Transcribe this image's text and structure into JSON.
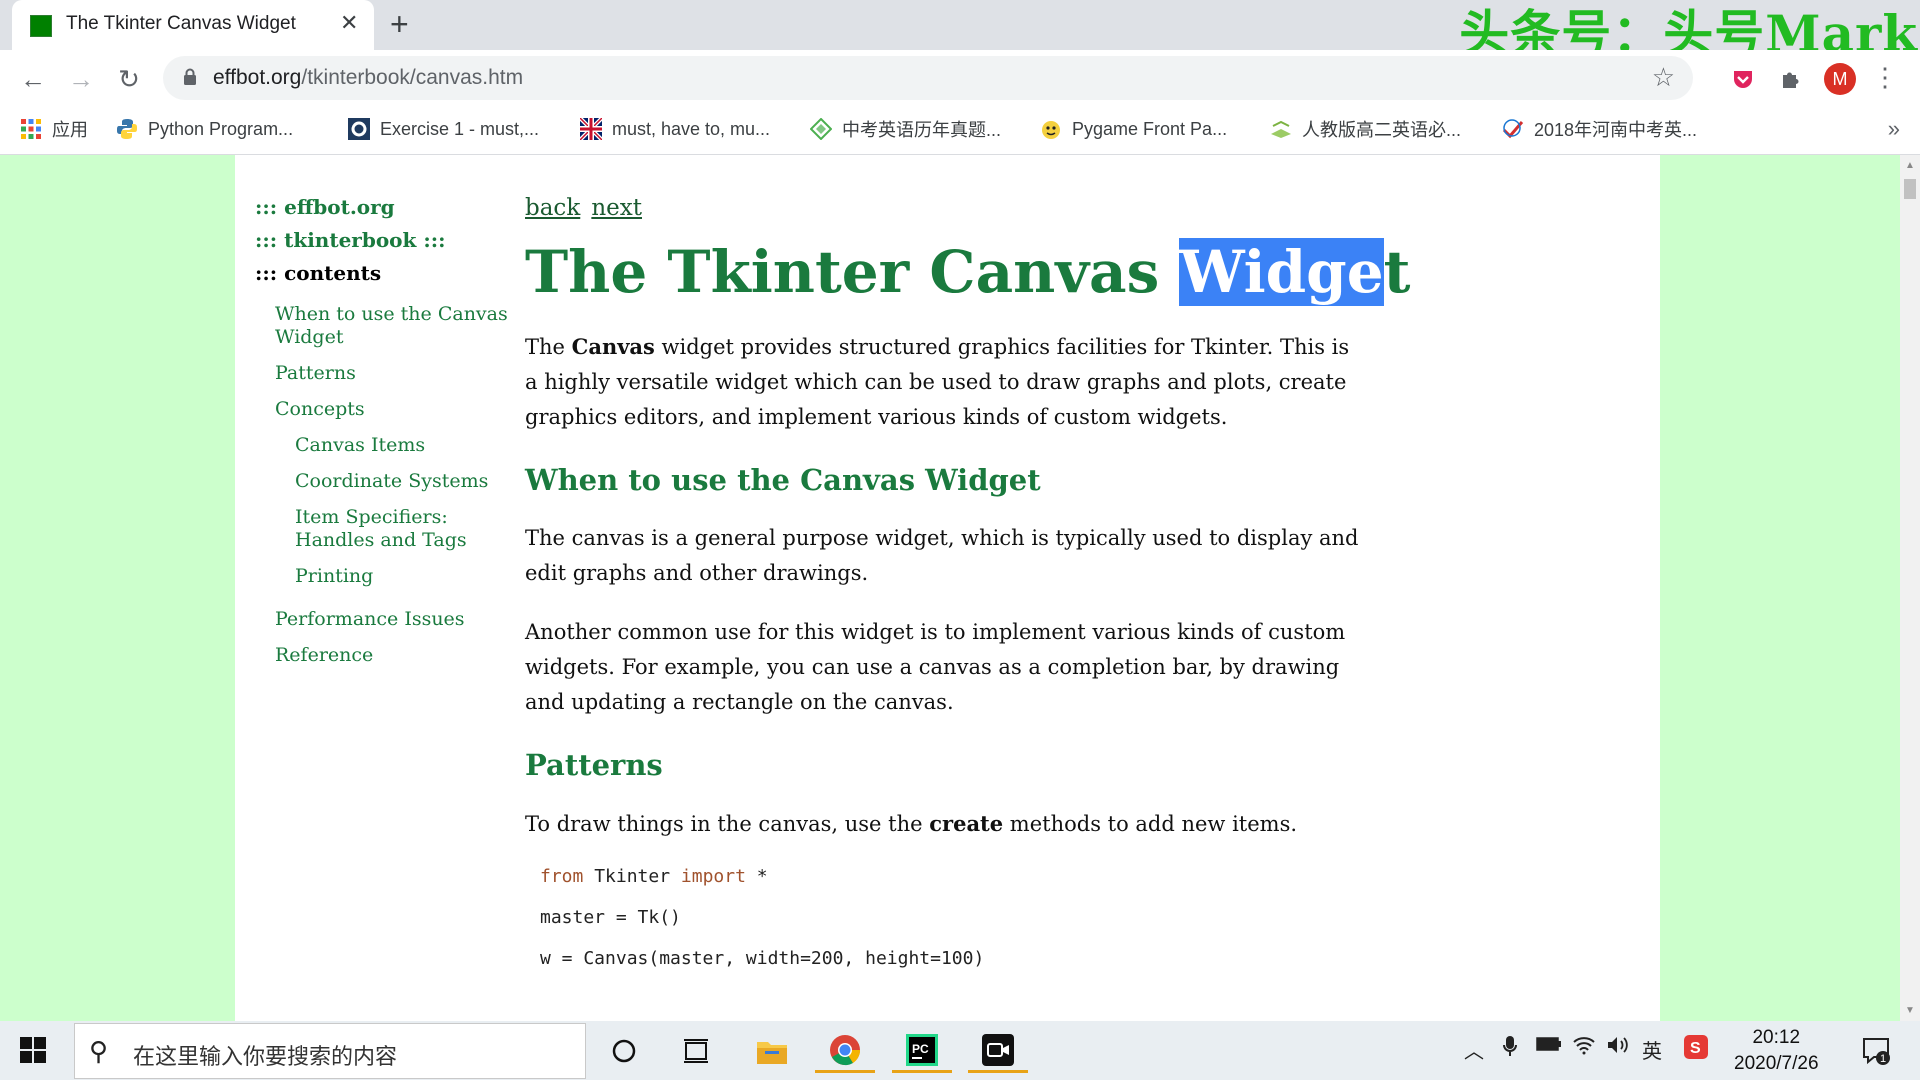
{
  "tab": {
    "title": "The Tkinter Canvas Widget",
    "close": "✕",
    "new_tab": "+"
  },
  "watermark": "头条号：头号Mark",
  "toolbar": {
    "back": "←",
    "forward": "→",
    "reload": "↻",
    "url_host": "effbot.org",
    "url_path": "/tkinterbook/canvas.htm",
    "star": "☆",
    "avatar": "M",
    "menu": "⋮"
  },
  "bookmarks": [
    {
      "label": "应用",
      "icon": "apps-grid-icon"
    },
    {
      "label": "Python Program...",
      "icon": "python-icon"
    },
    {
      "label": "Exercise 1 - must,...",
      "icon": "o-logo-icon"
    },
    {
      "label": "must, have to, mu...",
      "icon": "uk-flag-icon"
    },
    {
      "label": "中考英语历年真题...",
      "icon": "diamond-icon"
    },
    {
      "label": "Pygame Front Pa...",
      "icon": "pygame-icon"
    },
    {
      "label": "人教版高二英语必...",
      "icon": "book-icon"
    },
    {
      "label": "2018年河南中考英...",
      "icon": "check-logo-icon"
    }
  ],
  "bookmarks_more": "»",
  "sidebar": {
    "top_links": [
      "::: effbot.org",
      "::: tkinterbook :::"
    ],
    "current": "::: contents",
    "items": [
      {
        "label": "When to use the Canvas Widget",
        "level": 1
      },
      {
        "label": "Patterns",
        "level": 1
      },
      {
        "label": "Concepts",
        "level": 1
      },
      {
        "label": "Canvas Items",
        "level": 2
      },
      {
        "label": "Coordinate Systems",
        "level": 2
      },
      {
        "label": "Item Specifiers: Handles and Tags",
        "level": 2
      },
      {
        "label": "Printing",
        "level": 2
      },
      {
        "label": "Performance Issues",
        "level": 1
      },
      {
        "label": "Reference",
        "level": 1
      }
    ]
  },
  "content": {
    "back": "back",
    "next": "next",
    "title_pre": "The Tkinter Canvas ",
    "title_sel": "Widge",
    "title_post": "t",
    "intro_a": "The ",
    "intro_b": "Canvas",
    "intro_c": " widget provides structured graphics facilities for Tkinter. This is a highly versatile widget which can be used to draw graphs and plots, create graphics editors, and implement various kinds of custom widgets.",
    "h2_when": "When to use the Canvas Widget",
    "p_when1": "The canvas is a general purpose widget, which is typically used to display and edit graphs and other drawings.",
    "p_when2": "Another common use for this widget is to implement various kinds of custom widgets. For example, you can use a canvas as a completion bar, by drawing and updating a rectangle on the canvas.",
    "h2_patterns": "Patterns",
    "p_pat_a": "To draw things in the canvas, use the ",
    "p_pat_b": "create",
    "p_pat_c": " methods to add new items.",
    "code1_kw1": "from",
    "code1_mid": " Tkinter ",
    "code1_kw2": "import",
    "code1_end": " *",
    "code2": "master = Tk()",
    "code3": "w = Canvas(master, width=200, height=100)"
  },
  "taskbar": {
    "search_placeholder": "在这里输入你要搜索的内容",
    "tray_lang": "英",
    "time": "20:12",
    "date": "2020/7/26",
    "notif_count": "1"
  },
  "colors": {
    "page_bg": "#ccffcc",
    "heading": "#1a7a3e",
    "selection": "#3b82f6",
    "taskbar": "#e9eef2"
  }
}
